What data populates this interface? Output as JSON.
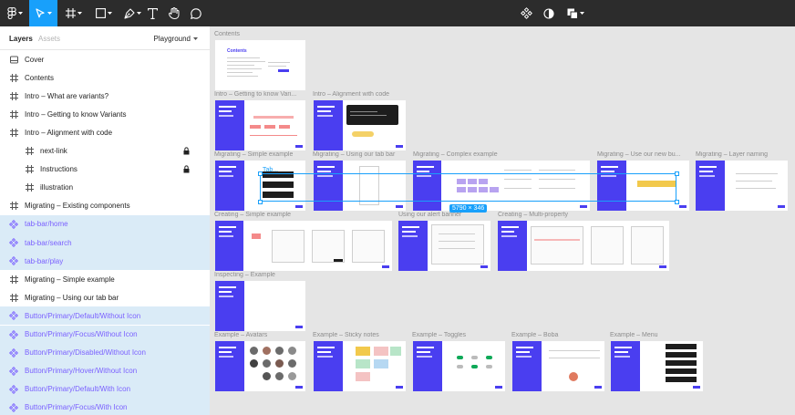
{
  "toolbar": {
    "icons": [
      "figma-menu-icon",
      "move-tool-icon",
      "frame-tool-icon",
      "shape-tool-icon",
      "pen-tool-icon",
      "text-tool-icon",
      "hand-tool-icon",
      "comment-tool-icon",
      "components-icon",
      "mask-icon",
      "boolean-icon"
    ],
    "active_tool": "move-tool-icon",
    "colors": {
      "bar": "#2c2c2c",
      "active": "#18a0fb"
    }
  },
  "left_panel": {
    "tabs": [
      "Layers",
      "Assets"
    ],
    "active_tab": "Layers",
    "page_select": "Playground",
    "layers": [
      {
        "label": "Cover",
        "icon": "frame-icon",
        "kind": "frame",
        "indent": 0,
        "selected": false,
        "locked": false
      },
      {
        "label": "Contents",
        "icon": "frame-icon",
        "kind": "frame",
        "indent": 0,
        "selected": false,
        "locked": false
      },
      {
        "label": "Intro – What are variants?",
        "icon": "frame-icon",
        "kind": "frame",
        "indent": 0,
        "selected": false,
        "locked": false
      },
      {
        "label": "Intro – Getting to know Variants",
        "icon": "frame-icon",
        "kind": "frame",
        "indent": 0,
        "selected": false,
        "locked": false
      },
      {
        "label": "Intro – Alignment with code",
        "icon": "frame-icon",
        "kind": "frame",
        "indent": 0,
        "selected": false,
        "locked": false
      },
      {
        "label": "next-link",
        "icon": "frame-icon",
        "kind": "frame",
        "indent": 1,
        "selected": false,
        "locked": true
      },
      {
        "label": "Instructions",
        "icon": "frame-icon",
        "kind": "frame",
        "indent": 1,
        "selected": false,
        "locked": true
      },
      {
        "label": "illustration",
        "icon": "frame-icon",
        "kind": "frame",
        "indent": 1,
        "selected": false,
        "locked": false
      },
      {
        "label": "Migrating – Existing components",
        "icon": "frame-icon",
        "kind": "frame",
        "indent": 0,
        "selected": false,
        "locked": false
      },
      {
        "label": "tab-bar/home",
        "icon": "component-icon",
        "kind": "component",
        "indent": 0,
        "selected": true,
        "locked": false
      },
      {
        "label": "tab-bar/search",
        "icon": "component-icon",
        "kind": "component",
        "indent": 0,
        "selected": true,
        "locked": false
      },
      {
        "label": "tab-bar/play",
        "icon": "component-icon",
        "kind": "component",
        "indent": 0,
        "selected": true,
        "locked": false
      },
      {
        "label": "Migrating – Simple example",
        "icon": "frame-icon",
        "kind": "frame",
        "indent": 0,
        "selected": false,
        "locked": false
      },
      {
        "label": "Migrating – Using our tab bar",
        "icon": "frame-icon",
        "kind": "frame",
        "indent": 0,
        "selected": false,
        "locked": false
      },
      {
        "label": "Button/Primary/Default/Without Icon",
        "icon": "component-icon",
        "kind": "component",
        "indent": 0,
        "selected": true,
        "locked": false
      },
      {
        "label": "Button/Primary/Focus/Without Icon",
        "icon": "component-icon",
        "kind": "component",
        "indent": 0,
        "selected": true,
        "locked": false
      },
      {
        "label": "Button/Primary/Disabled/Without Icon",
        "icon": "component-icon",
        "kind": "component",
        "indent": 0,
        "selected": true,
        "locked": false
      },
      {
        "label": "Button/Primary/Hover/Without Icon",
        "icon": "component-icon",
        "kind": "component",
        "indent": 0,
        "selected": true,
        "locked": false
      },
      {
        "label": "Button/Primary/Default/With Icon",
        "icon": "component-icon",
        "kind": "component",
        "indent": 0,
        "selected": true,
        "locked": false
      },
      {
        "label": "Button/Primary/Focus/With Icon",
        "icon": "component-icon",
        "kind": "component",
        "indent": 0,
        "selected": true,
        "locked": false
      }
    ]
  },
  "canvas": {
    "frame_labels": {
      "contents": "Contents",
      "intro_variants": "Intro – Getting to know Vari...",
      "intro_alignment": "Intro – Alignment with code",
      "mig_simple": "Migrating – Simple example",
      "mig_tabbar": "Migrating – Using our tab bar",
      "mig_complex": "Migrating – Complex example",
      "mig_new": "Migrating – Use our new bu...",
      "mig_layer": "Migrating – Layer naming",
      "create_simple": "Creating – Simple example",
      "alert": "Using our alert banner",
      "create_multi": "Creating – Multi-property",
      "inspecting": "Inspecting – Example",
      "avatars": "Example – Avatars",
      "sticky": "Example – Sticky notes",
      "toggles": "Example – Toggles",
      "boba": "Example – Boba",
      "menu": "Example – Menu"
    },
    "contents_heading": "Contents",
    "selection_label": "Tab...",
    "size_badge": "5790 × 346",
    "colors": {
      "canvas": "#e5e5e5",
      "accent": "#4a3ef0",
      "selection": "#18a0fb",
      "component": "#7b61ff",
      "selected_row": "#daebf7"
    }
  }
}
